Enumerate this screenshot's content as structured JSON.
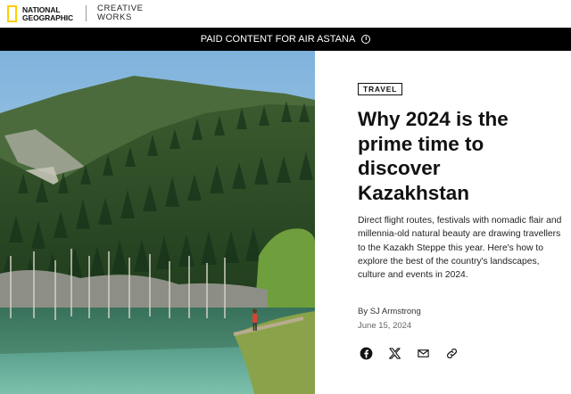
{
  "header": {
    "logo_line1": "NATIONAL",
    "logo_line2": "GEOGRAPHIC",
    "partner_line1": "CREATIVE",
    "partner_line2": "WORKS"
  },
  "banner": {
    "text": "PAID CONTENT FOR AIR ASTANA",
    "info_symbol": "i"
  },
  "hero": {
    "icon": "mountain-lake-photo"
  },
  "article": {
    "tag": "TRAVEL",
    "headline": "Why 2024 is the prime time to discover Kazakhstan",
    "dek": "Direct flight routes, festivals with nomadic flair and millennia-old natural beauty are drawing travellers to the Kazakh Steppe this year. Here's how to explore the best of the country's landscapes, culture and events in 2024.",
    "byline": "By SJ Armstrong",
    "date": "June 15, 2024"
  },
  "share": {
    "icons": [
      "facebook-icon",
      "x-icon",
      "email-icon",
      "link-icon"
    ]
  },
  "colors": {
    "brand_yellow": "#ffcd00",
    "banner_bg": "#000000"
  }
}
